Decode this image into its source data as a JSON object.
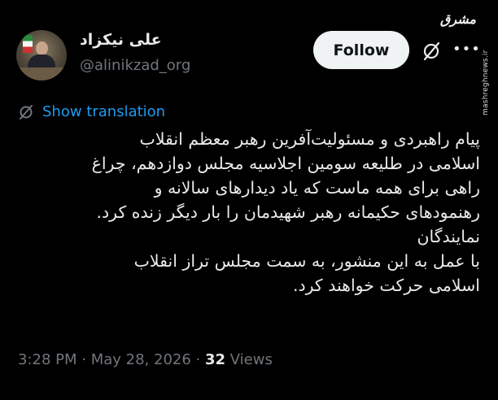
{
  "author": {
    "name": "علی نیکزاد",
    "handle": "@alinikzad_org"
  },
  "actions": {
    "follow_label": "Follow",
    "grok_icon": "grok-icon",
    "more_icon": "more-icon"
  },
  "watermark": {
    "logo": "مشرق",
    "url": "mashreghnews.ir"
  },
  "translation": {
    "label": "Show translation",
    "icon": "translate-icon"
  },
  "tweet": {
    "lines": [
      "پیام راهبردی و مسئولیت‌آفرین رهبر معظم انقلاب",
      "اسلامی در طلیعه سومین اجلاسیه مجلس دوازدهم، چراغ",
      "راهی برای همه ماست که یاد دیدارهای سالانه و",
      "رهنمودهای حکیمانه رهبر شهیدمان را بار دیگر زنده کرد.",
      "نمایندگان",
      " با عمل به این منشور، به سمت مجلس تراز انقلاب",
      "اسلامی حرکت خواهند کرد."
    ]
  },
  "meta": {
    "time": "3:28 PM",
    "separator": " · ",
    "date": "May 28, 2026",
    "views_count": "32",
    "views_label": " Views"
  },
  "colors": {
    "background": "#000000",
    "text": "#e7e9ea",
    "secondary": "#71767b",
    "link": "#1d9bf0",
    "button_bg": "#eff3f4"
  }
}
